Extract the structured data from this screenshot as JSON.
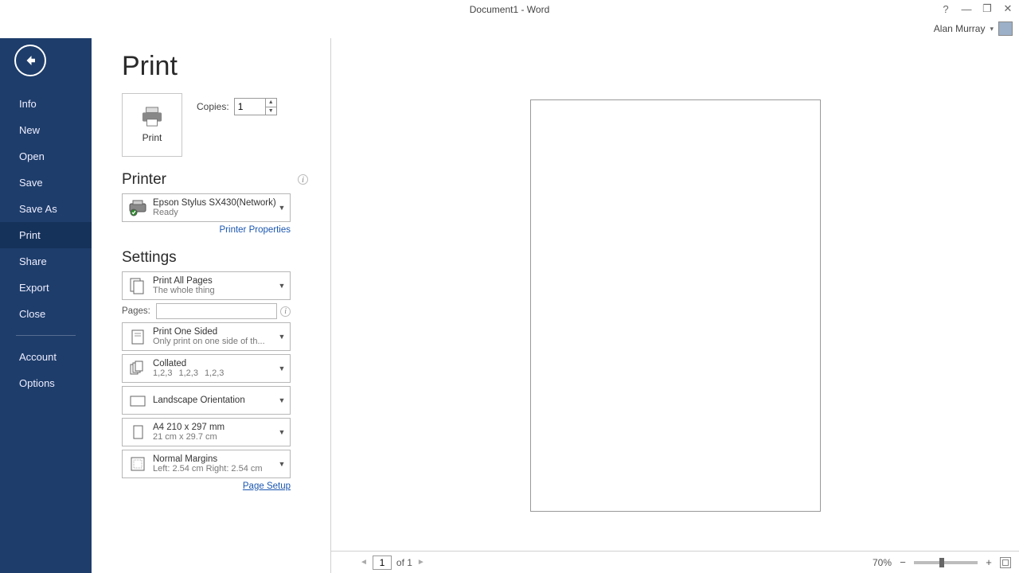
{
  "title": "Document1 - Word",
  "user": {
    "name": "Alan Murray"
  },
  "sidebar": {
    "items": [
      {
        "label": "Info"
      },
      {
        "label": "New"
      },
      {
        "label": "Open"
      },
      {
        "label": "Save"
      },
      {
        "label": "Save As"
      },
      {
        "label": "Print"
      },
      {
        "label": "Share"
      },
      {
        "label": "Export"
      },
      {
        "label": "Close"
      }
    ],
    "footer": [
      {
        "label": "Account"
      },
      {
        "label": "Options"
      }
    ],
    "active": "Print"
  },
  "page": {
    "heading": "Print",
    "print_button": "Print",
    "copies": {
      "label": "Copies:",
      "value": "1"
    },
    "printer": {
      "heading": "Printer",
      "name": "Epson Stylus SX430(Network)",
      "status": "Ready",
      "properties_link": "Printer Properties"
    },
    "settings": {
      "heading": "Settings",
      "scope": {
        "title": "Print All Pages",
        "sub": "The whole thing"
      },
      "pages": {
        "label": "Pages:",
        "value": ""
      },
      "sides": {
        "title": "Print One Sided",
        "sub": "Only print on one side of th..."
      },
      "collate": {
        "title": "Collated",
        "sub1": "1,2,3",
        "sub2": "1,2,3",
        "sub3": "1,2,3"
      },
      "orientation": {
        "title": "Landscape Orientation"
      },
      "paper": {
        "title": "A4 210 x 297 mm",
        "sub": "21 cm x 29.7 cm"
      },
      "margins": {
        "title": "Normal Margins",
        "sub": "Left:  2.54 cm    Right:  2.54 cm"
      },
      "page_setup_link": "Page Setup"
    }
  },
  "status": {
    "current_page": "1",
    "total_pages": "of 1",
    "zoom": "70%"
  }
}
